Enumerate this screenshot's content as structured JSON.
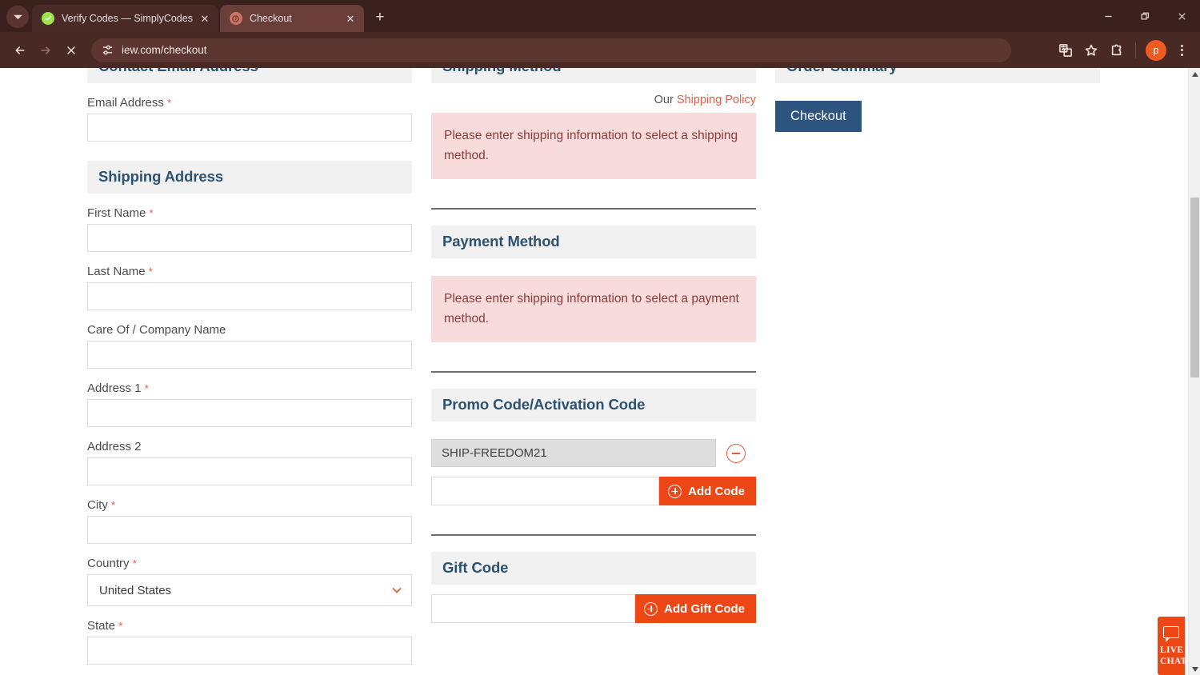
{
  "browser": {
    "tabs": [
      {
        "title": "Verify Codes — SimplyCodes",
        "favicon": "shield-check-icon",
        "active": false,
        "close_label": "✕"
      },
      {
        "title": "Checkout",
        "favicon": "site-icon",
        "active": true,
        "close_label": "✕"
      }
    ],
    "new_tab_label": "+",
    "tab_search_icon": "chevron-down-icon",
    "nav": {
      "back_icon": "back-arrow-icon",
      "forward_icon": "forward-arrow-icon",
      "stop_icon": "stop-loading-icon"
    },
    "omnibox": {
      "site_settings_icon": "tune-icon",
      "url": "iew.com/checkout"
    },
    "toolbar_right": {
      "translate_icon": "translate-icon",
      "bookmark_icon": "star-icon",
      "extensions_icon": "puzzle-icon",
      "profile_initial": "p",
      "menu_icon": "three-dots-icon"
    },
    "window_controls": {
      "minimize": "minimize-icon",
      "restore": "restore-icon",
      "close": "close-icon"
    }
  },
  "page": {
    "left_column": {
      "contact_section_title": "Contact Email Address",
      "email_label": "Email Address",
      "email_value": "",
      "shipping_section_title": "Shipping Address",
      "fields": [
        {
          "label": "First Name",
          "required": true,
          "value": ""
        },
        {
          "label": "Last Name",
          "required": true,
          "value": ""
        },
        {
          "label": "Care Of / Company Name",
          "required": false,
          "value": ""
        },
        {
          "label": "Address 1",
          "required": true,
          "value": ""
        },
        {
          "label": "Address 2",
          "required": false,
          "value": ""
        },
        {
          "label": "City",
          "required": true,
          "value": ""
        }
      ],
      "country_label": "Country",
      "country_value": "United States",
      "state_label": "State",
      "required_marker": "*"
    },
    "middle_column": {
      "shipping_method_title": "Shipping Method",
      "policy_prefix": "Our",
      "policy_link": "Shipping Policy",
      "shipping_alert": "Please enter shipping information to select a shipping method.",
      "payment_method_title": "Payment Method",
      "payment_alert": "Please enter shipping information to select a payment method.",
      "promo_title": "Promo Code/Activation Code",
      "applied_code": "SHIP-FREEDOM21",
      "remove_code_icon": "minus-circle-icon",
      "promo_input_value": "",
      "add_code_label": "Add Code",
      "gift_title": "Gift Code",
      "gift_input_value": "",
      "add_gift_label": "Add Gift Code"
    },
    "right_column": {
      "order_summary_title": "Order Summary",
      "checkout_label": "Checkout"
    },
    "live_chat": {
      "line1": "LIVE",
      "line2": "CHAT",
      "icon": "chat-bubble-icon"
    },
    "colors": {
      "accent_orange": "#ec4715",
      "heading_blue": "#2c5271",
      "checkout_blue": "#2d5580",
      "alert_pink_bg": "#f8dcdc",
      "alert_text": "#8a3b3b",
      "section_bg": "#f1f1f1",
      "link_orange": "#d9624a",
      "browser_chrome": "#3b211d"
    }
  }
}
